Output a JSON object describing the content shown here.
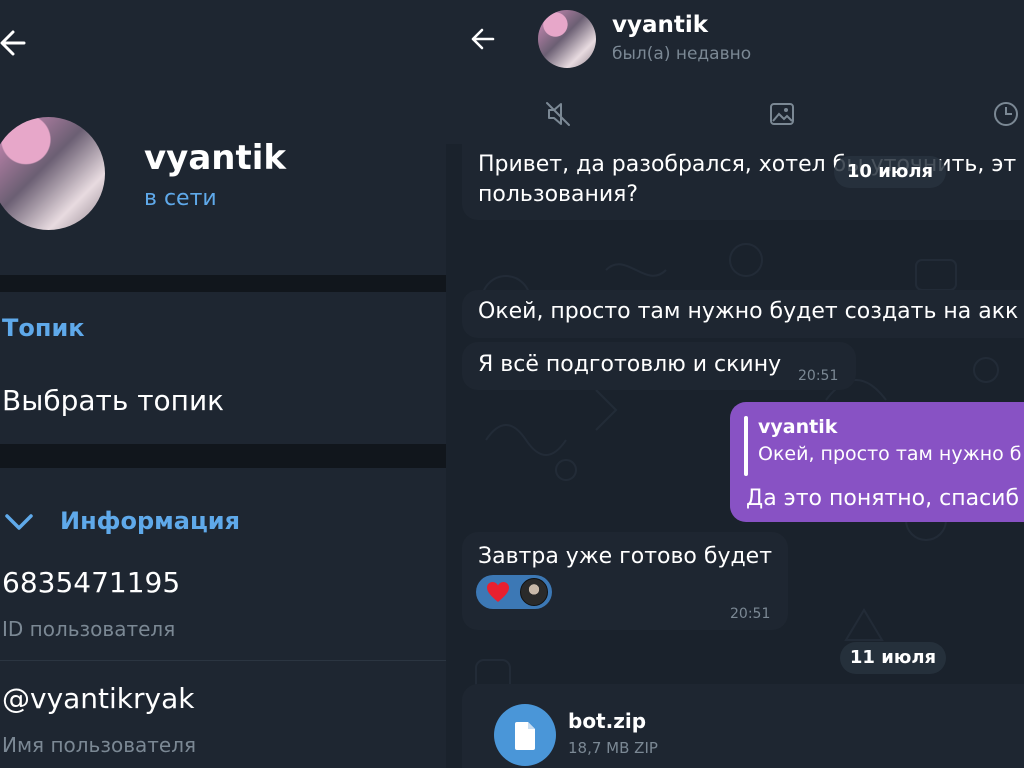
{
  "profile": {
    "name": "vyantik",
    "status": "в сети",
    "topic_label": "Топик",
    "topic_value": "Выбрать топик",
    "info_title": "Информация",
    "user_id": "6835471195",
    "user_id_label": "ID пользователя",
    "username": "@vyantikryak",
    "username_label": "Имя пользователя"
  },
  "chat": {
    "name": "vyantik",
    "status": "был(а) недавно",
    "dates": [
      "10 июля",
      "11 июля"
    ],
    "messages": [
      {
        "dir": "in",
        "text_line1": "Привет, да разобрался, хотел бы уточнить, эт",
        "text_line2": "пользования?"
      },
      {
        "dir": "in",
        "text": "Окей, просто там нужно будет создать на акк"
      },
      {
        "dir": "in",
        "text": "Я всё подготовлю и скину",
        "time": "20:51"
      },
      {
        "dir": "out",
        "reply_name": "vyantik",
        "reply_text": "Окей, просто там нужно б",
        "text": "Да это понятно, спасиб"
      },
      {
        "dir": "in",
        "text": "Завтра уже готово будет",
        "time": "20:51"
      }
    ],
    "file": {
      "name": "bot.zip",
      "meta": "18,7 MB ZIP"
    }
  },
  "icons": {
    "back": "arrow-left-icon",
    "chevron": "chevron-down-icon",
    "mute": "speaker-muted-icon",
    "media": "image-icon",
    "clock": "clock-icon",
    "file": "document-icon",
    "heart": "heart-icon"
  },
  "colors": {
    "accent": "#5fa9ea",
    "outgoing_bubble": "#8852c4",
    "incoming_bubble": "#1e2631",
    "panel": "#1e2631",
    "background": "#11161c",
    "reaction": "#3c78b5"
  }
}
